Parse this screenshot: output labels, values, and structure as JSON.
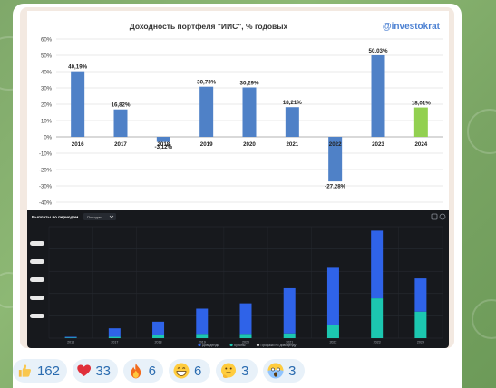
{
  "chart_data": [
    {
      "type": "bar",
      "title": "Доходность портфеля \"ИИС\", % годовых",
      "watermark": "@investokrat",
      "categories": [
        "2016",
        "2017",
        "2018",
        "2019",
        "2020",
        "2021",
        "2022",
        "2023",
        "2024"
      ],
      "values": [
        40.19,
        16.82,
        -3.12,
        30.73,
        30.29,
        18.21,
        -27.28,
        50.03,
        18.01
      ],
      "value_labels": [
        "40,19%",
        "16,82%",
        "-3,12%",
        "30,73%",
        "30,29%",
        "18,21%",
        "-27,28%",
        "50,03%",
        "18,01%"
      ],
      "yticks": [
        "60%",
        "50%",
        "40%",
        "30%",
        "20%",
        "10%",
        "0%",
        "-10%",
        "-20%",
        "-30%",
        "-40%"
      ],
      "ylim": [
        -40,
        60
      ],
      "colors": {
        "default": "#4f81c7",
        "highlight": "#92d050"
      },
      "highlight_index": 8,
      "grid": true
    },
    {
      "type": "bar",
      "stacked": true,
      "title": "Выплаты по периодам",
      "dropdown": "По годам",
      "categories": [
        "2016",
        "2017",
        "2018",
        "2019",
        "2020",
        "2021",
        "2022",
        "2023",
        "2024"
      ],
      "series": [
        {
          "name": "Дивиденды",
          "color": "#2f63e8",
          "values": [
            0.3,
            3.2,
            5.0,
            9.5,
            11.5,
            17.0,
            21.5,
            25.5,
            12.5
          ]
        },
        {
          "name": "Купоны",
          "color": "#1cc7b0",
          "values": [
            0.2,
            0.5,
            1.2,
            1.6,
            1.6,
            1.8,
            5.0,
            15.0,
            10.0
          ]
        },
        {
          "name": "Продажи по дивиденду",
          "color": "#d0d0d0",
          "values": [
            0,
            0,
            0,
            0,
            0,
            0,
            0,
            0,
            0
          ]
        }
      ],
      "ylim": [
        0,
        42
      ],
      "grid": true
    }
  ],
  "reactions": [
    {
      "emoji": "thumbs-up",
      "count": "162"
    },
    {
      "emoji": "red-heart",
      "count": "33"
    },
    {
      "emoji": "fire",
      "count": "6"
    },
    {
      "emoji": "grinning-face",
      "count": "6"
    },
    {
      "emoji": "thinking-face",
      "count": "3"
    },
    {
      "emoji": "screaming-face",
      "count": "3"
    }
  ]
}
